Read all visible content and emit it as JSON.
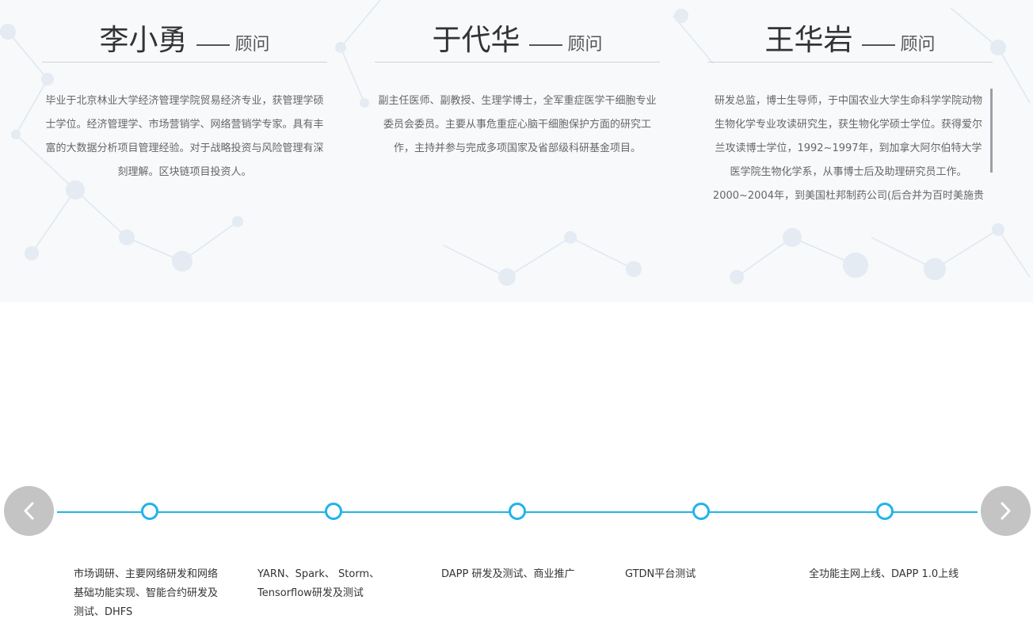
{
  "advisors": [
    {
      "name": "李小勇",
      "role": "顾问",
      "description": "毕业于北京林业大学经济管理学院贸易经济专业，获管理学硕士学位。经济管理学、市场营销学、网络营销学专家。具有丰富的大数据分析项目管理经验。对于战略投资与风险管理有深刻理解。区块链项目投资人。"
    },
    {
      "name": "于代华",
      "role": "顾问",
      "description": "副主任医师、副教授、生理学博士，全军重症医学干细胞专业委员会委员。主要从事危重症心脑干细胞保护方面的研究工作，主持并参与完成多项国家及省部级科研基金项目。"
    },
    {
      "name": "王华岩",
      "role": "顾问",
      "description": "研发总监，博士生导师，于中国农业大学生命科学学院动物生物化学专业攻读研究生，获生物化学硕士学位。获得爱尔兰攻读博士学位，1992~1997年，到加拿大阿尔伯特大学医学院生物化学系，从事博士后及助理研究员工作。2000~2004年，到美国杜邦制药公司(后合并为百时美施贵"
    }
  ],
  "timeline": {
    "prev_icon": "chevron-left-icon",
    "next_icon": "chevron-right-icon",
    "milestones": [
      {
        "label": "市场调研、主要网络研发和网络基础功能实现、智能合约研发及测试、DHFS"
      },
      {
        "label": "YARN、Spark、 Storm、Tensorflow研发及测试"
      },
      {
        "label": "DAPP 研发及测试、商业推广"
      },
      {
        "label": "GTDN平台测试"
      },
      {
        "label": "全功能主网上线、DAPP 1.0上线"
      }
    ]
  },
  "colors": {
    "accent": "#1fb4ea",
    "arrow_bg": "#c4c4c4",
    "section_bg": "#f7f9fb"
  }
}
